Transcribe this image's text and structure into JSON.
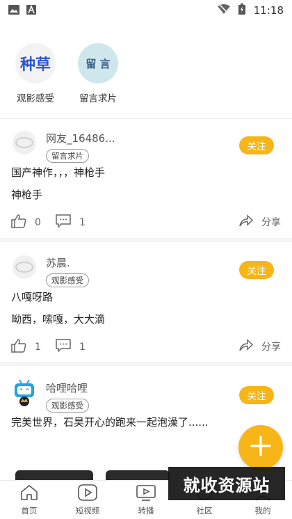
{
  "status_bar": {
    "time": "11:18"
  },
  "categories": [
    {
      "icon_text": "种草",
      "label": "观影感受"
    },
    {
      "icon_text": "留 言",
      "label": "留言求片"
    }
  ],
  "posts": [
    {
      "user": "网友_16486...",
      "tag": "留言求片",
      "follow_label": "关注",
      "lines": [
        "国产神作，，，神枪手",
        "神枪手"
      ],
      "likes": "0",
      "comments": "1",
      "share_label": "分享"
    },
    {
      "user": "苏晨.",
      "tag": "观影感受",
      "follow_label": "关注",
      "lines": [
        "八嘎呀路",
        "呦西，嗦嘎，大大滴"
      ],
      "likes": "1",
      "comments": "1",
      "share_label": "分享"
    },
    {
      "user": "哈哩哈哩",
      "tag": "观影感受",
      "follow_label": "关注",
      "lines": [
        "完美世界，石昊开心的跑来一起泡澡了......"
      ]
    }
  ],
  "fab_icon": "plus-icon",
  "bottom_nav": [
    {
      "label": "首页",
      "icon": "home-icon"
    },
    {
      "label": "短视频",
      "icon": "play-icon"
    },
    {
      "label": "转播",
      "icon": "tv-icon"
    },
    {
      "label": "社区",
      "icon": "community-icon"
    },
    {
      "label": "我的",
      "icon": "profile-icon"
    }
  ],
  "watermark": "就收资源站",
  "colors": {
    "accent": "#f7b517",
    "text": "#222222",
    "muted": "#666666"
  }
}
